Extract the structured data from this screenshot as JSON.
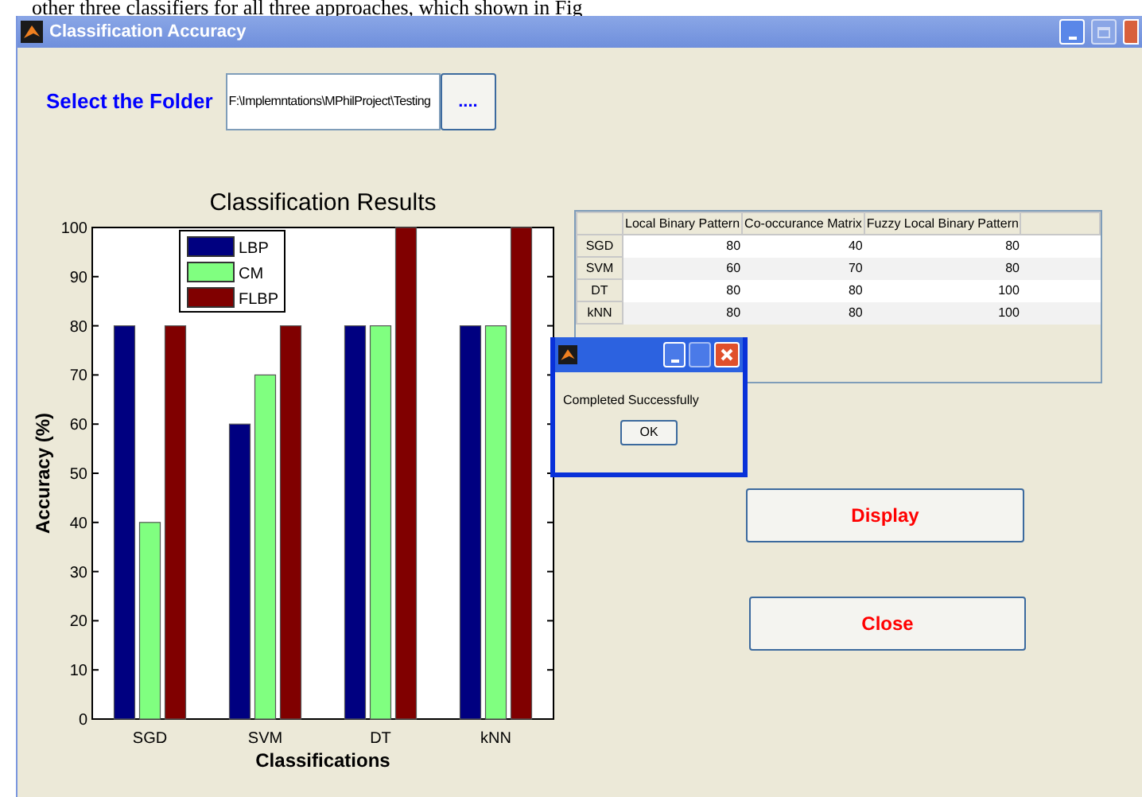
{
  "document_text": "other three classifiers for all three approaches, which shown in Fig",
  "window": {
    "title": "Classification Accuracy"
  },
  "folder": {
    "label": "Select the Folder",
    "value": "F:\\Implemntations\\MPhilProject\\Testing",
    "browse_button": "...."
  },
  "chart_data": {
    "type": "bar",
    "title": "Classification Results",
    "xlabel": "Classifications",
    "ylabel": "Accuracy (%)",
    "categories": [
      "SGD",
      "SVM",
      "DT",
      "kNN"
    ],
    "series": [
      {
        "name": "LBP",
        "color": "#000080",
        "values": [
          80,
          60,
          80,
          80
        ]
      },
      {
        "name": "CM",
        "color": "#80ff80",
        "values": [
          40,
          70,
          80,
          80
        ]
      },
      {
        "name": "FLBP",
        "color": "#800000",
        "values": [
          80,
          80,
          100,
          100
        ]
      }
    ],
    "legend": "upper left",
    "ylim": [
      0,
      100
    ],
    "yticks": [
      0,
      10,
      20,
      30,
      40,
      50,
      60,
      70,
      80,
      90,
      100
    ]
  },
  "table": {
    "columns": [
      "Local Binary Pattern",
      "Co-occurance Matrix",
      "Fuzzy Local Binary Pattern"
    ],
    "rows": [
      {
        "label": "SGD",
        "cells": [
          "80",
          "40",
          "80"
        ]
      },
      {
        "label": "SVM",
        "cells": [
          "60",
          "70",
          "80"
        ]
      },
      {
        "label": "DT",
        "cells": [
          "80",
          "80",
          "100"
        ]
      },
      {
        "label": "kNN",
        "cells": [
          "80",
          "80",
          "100"
        ]
      }
    ]
  },
  "dialog": {
    "message": "Completed Successfully",
    "button": "OK"
  },
  "buttons": [
    "Display",
    "Close"
  ]
}
